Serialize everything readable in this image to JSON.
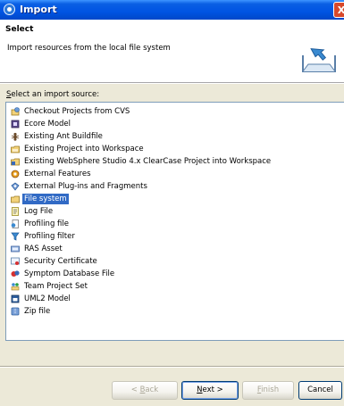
{
  "window": {
    "title": "Import",
    "close_label": "X"
  },
  "header": {
    "title": "Select",
    "description": "Import resources from the local file system"
  },
  "source_label": {
    "mnemonic": "S",
    "rest": "elect an import source:"
  },
  "items": [
    {
      "label": "Checkout Projects from CVS",
      "icon": "cvs-icon",
      "selected": false
    },
    {
      "label": "Ecore Model",
      "icon": "ecore-icon",
      "selected": false
    },
    {
      "label": "Existing Ant Buildfile",
      "icon": "ant-icon",
      "selected": false
    },
    {
      "label": "Existing Project into Workspace",
      "icon": "project-icon",
      "selected": false
    },
    {
      "label": "Existing WebSphere Studio 4.x ClearCase Project into Workspace",
      "icon": "clearcase-icon",
      "selected": false
    },
    {
      "label": "External Features",
      "icon": "features-icon",
      "selected": false
    },
    {
      "label": "External Plug-ins and Fragments",
      "icon": "plugin-icon",
      "selected": false
    },
    {
      "label": "File system",
      "icon": "folder-icon",
      "selected": true
    },
    {
      "label": "Log File",
      "icon": "log-icon",
      "selected": false
    },
    {
      "label": "Profiling file",
      "icon": "profiling-file-icon",
      "selected": false
    },
    {
      "label": "Profiling filter",
      "icon": "profiling-filter-icon",
      "selected": false
    },
    {
      "label": "RAS Asset",
      "icon": "ras-icon",
      "selected": false
    },
    {
      "label": "Security Certificate",
      "icon": "certificate-icon",
      "selected": false
    },
    {
      "label": "Symptom Database File",
      "icon": "symptom-icon",
      "selected": false
    },
    {
      "label": "Team Project Set",
      "icon": "team-icon",
      "selected": false
    },
    {
      "label": "UML2 Model",
      "icon": "uml-icon",
      "selected": false
    },
    {
      "label": "Zip file",
      "icon": "zip-icon",
      "selected": false
    }
  ],
  "buttons": {
    "back": {
      "pre": "< ",
      "mnemonic": "B",
      "rest": "ack"
    },
    "next": {
      "mnemonic": "N",
      "rest": "ext >"
    },
    "finish": {
      "mnemonic": "F",
      "rest": "inish"
    },
    "cancel": "Cancel"
  },
  "colors": {
    "titlebar": "#0054e3",
    "selection": "#316ac5",
    "dialog_bg": "#ece9d8"
  }
}
